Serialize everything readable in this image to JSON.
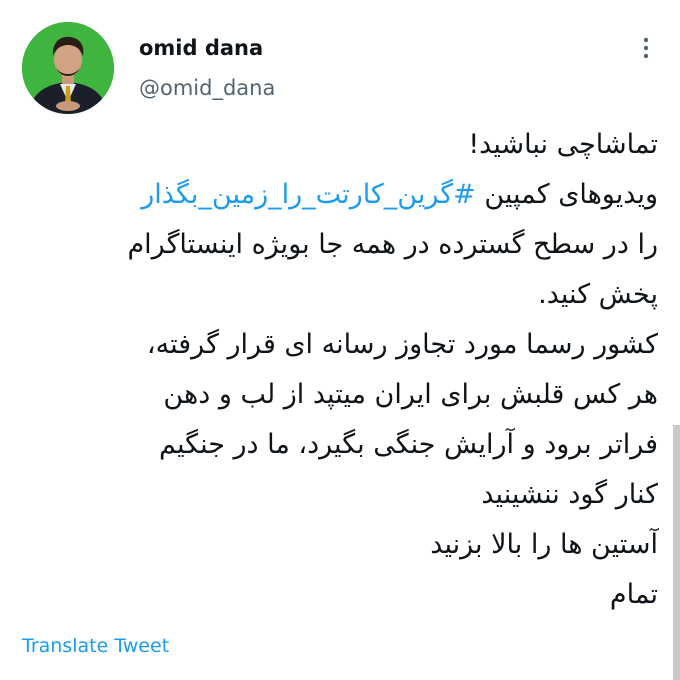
{
  "tweet": {
    "author": {
      "display_name": "omid dana",
      "handle": "@omid_dana",
      "avatar_icon": "profile-photo"
    },
    "more_icon": "vertical-ellipsis-icon",
    "body_lines": [
      "تماشاچی نباشید!",
      "ویدیوهای کمپین ",
      "را در سطح گسترده در همه جا بویژه اینستاگرام",
      "پخش کنید.",
      "کشور رسما مورد تجاوز رسانه ای قرار گرفته،",
      "هر کس قلبش برای ایران میتپد از لب و دهن",
      "فراتر برود و آرایش جنگی بگیرد، ما در جنگیم",
      "کنار گود ننشینید",
      "آستین ها را بالا بزنید",
      "تمام"
    ],
    "hashtag": "#گرین_کارتت_را_زمین_بگذار",
    "translate_label": "Translate Tweet"
  },
  "colors": {
    "text": "#0f1419",
    "secondary": "#536471",
    "link": "#1d9bf0",
    "avatar_bg": "#3fb43f"
  }
}
